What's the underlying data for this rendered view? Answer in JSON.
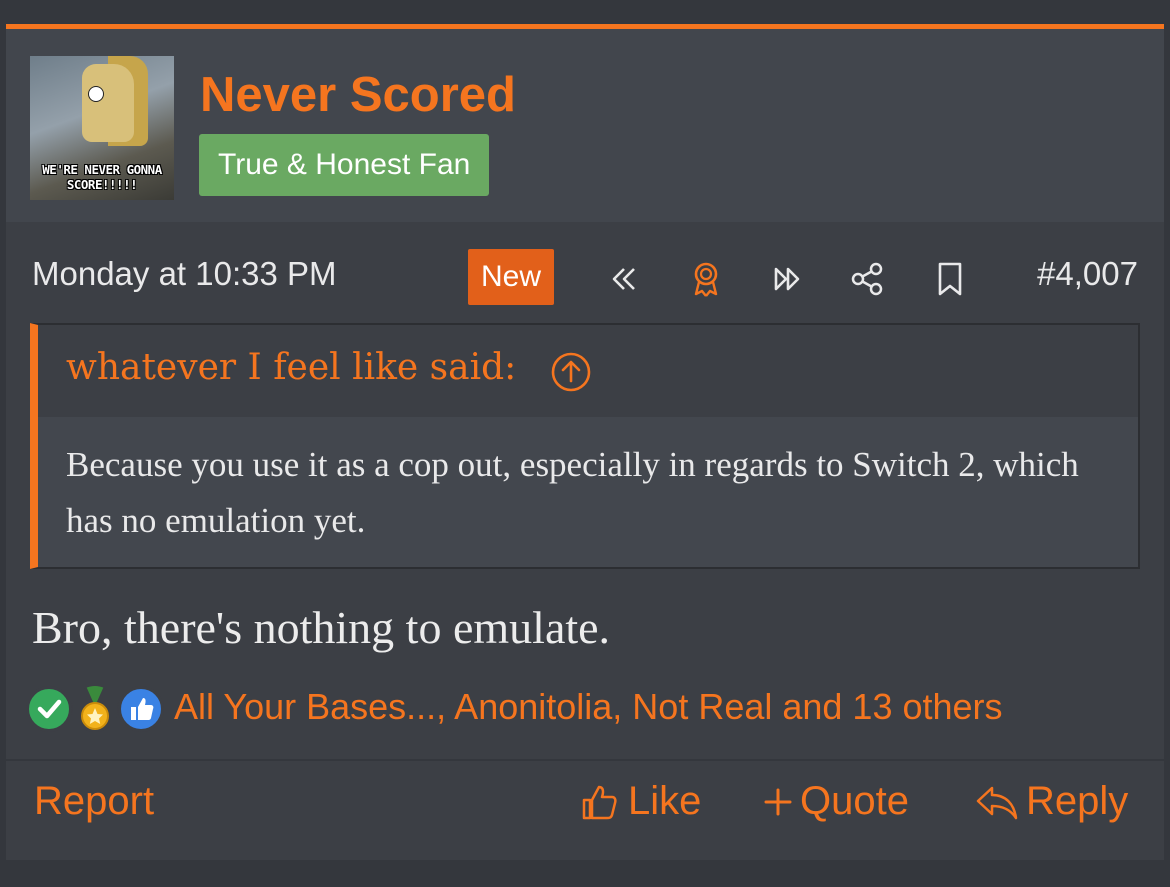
{
  "user": {
    "name": "Never Scored",
    "title": "True & Honest Fan",
    "avatar_caption": "WE'RE NEVER GONNA SCORE!!!!!"
  },
  "meta": {
    "timestamp": "Monday at 10:33 PM",
    "new_badge": "New",
    "post_number": "#4,007",
    "icons": [
      "rewind-icon",
      "award-icon",
      "fast-forward-icon",
      "share-icon",
      "bookmark-icon"
    ]
  },
  "quote": {
    "author": "whatever I feel like said:",
    "text": "Because you use it as a cop out, especially in regards to Switch 2, which has no emulation yet."
  },
  "message": {
    "text": "Bro, there's nothing to emulate."
  },
  "reactions": {
    "icons": [
      "check-reaction-icon",
      "medal-reaction-icon",
      "thumbs-up-reaction-icon"
    ],
    "users_text": "All Your Bases..., Anonitolia, Not Real and 13 others"
  },
  "actions": {
    "report": "Report",
    "like": "Like",
    "quote": "Quote",
    "reply": "Reply"
  },
  "colors": {
    "accent": "#f5751f",
    "title_badge": "#6aa962",
    "background": "#3c3f45"
  }
}
